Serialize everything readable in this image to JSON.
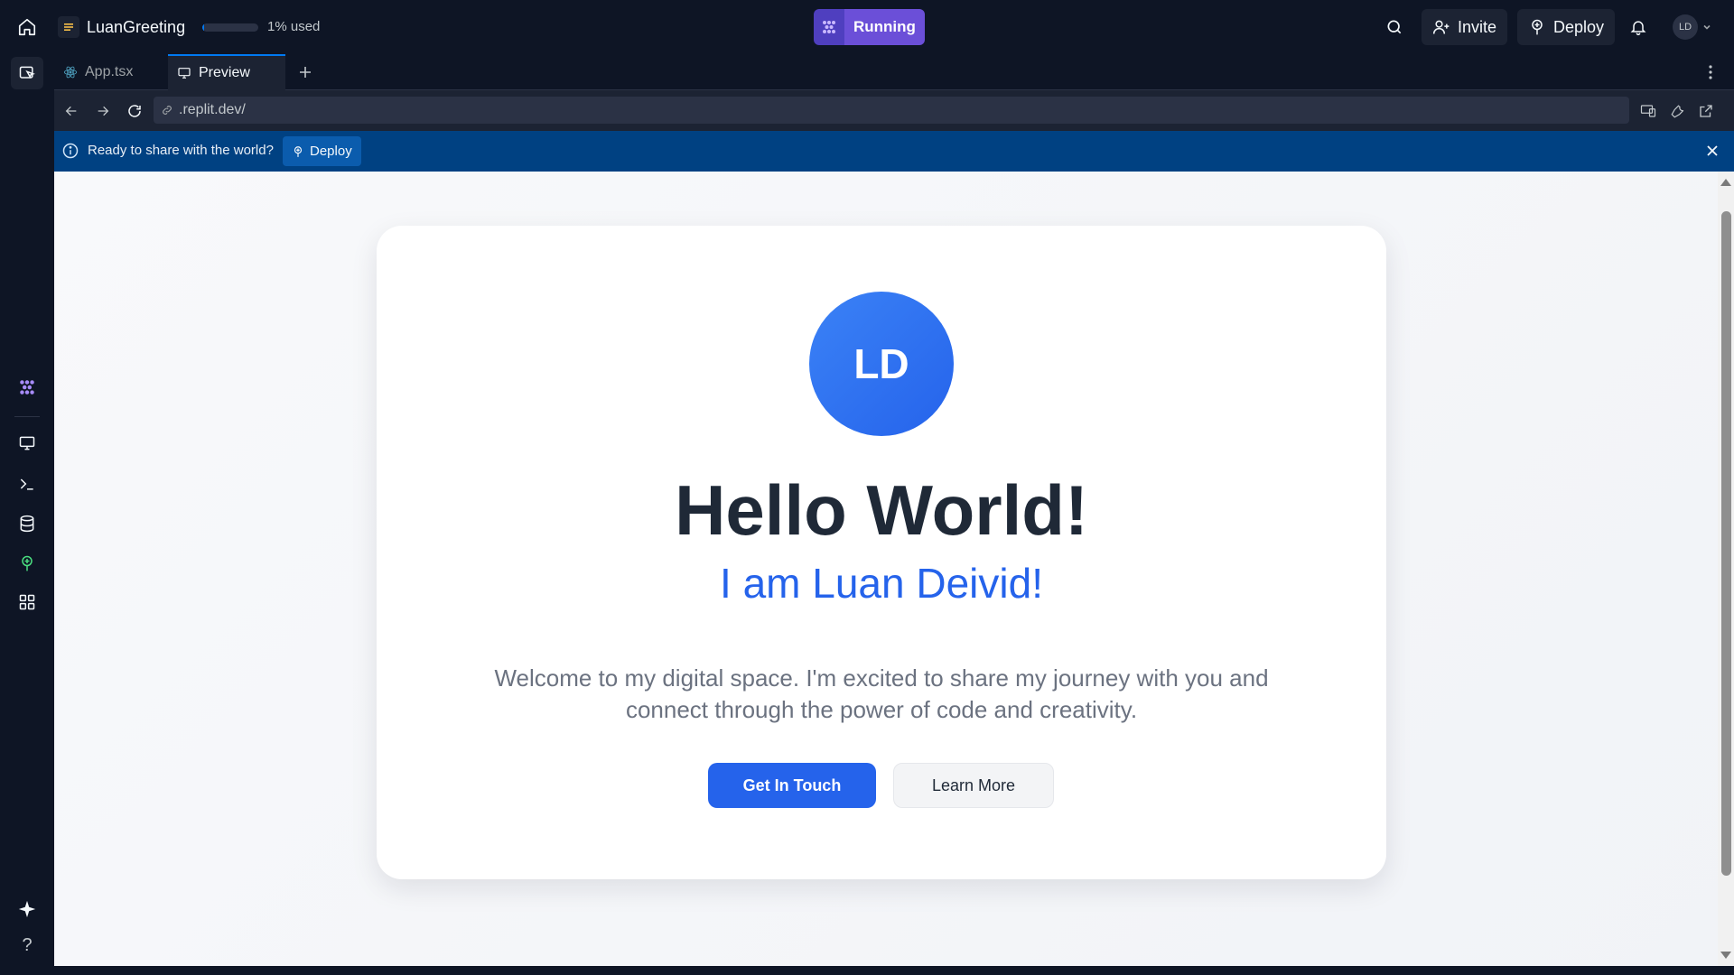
{
  "topbar": {
    "repl_name": "LuanGreeting",
    "usage_text": "1% used",
    "usage_fraction": 0.01,
    "run_label": "Running",
    "invite_label": "Invite",
    "deploy_label": "Deploy",
    "user_initials": "LD"
  },
  "tabs": [
    {
      "label": "App.tsx",
      "icon": "react-icon",
      "active": false
    },
    {
      "label": "Preview",
      "icon": "monitor-icon",
      "active": true
    }
  ],
  "urlbar": {
    "url": ".replit.dev/"
  },
  "banner": {
    "text": "Ready to share with the world?",
    "deploy_label": "Deploy"
  },
  "preview": {
    "avatar_initials": "LD",
    "title": "Hello World!",
    "subtitle": "I am Luan Deivid!",
    "description": "Welcome to my digital space. I'm excited to share my journey with you and connect through the power of code and creativity.",
    "primary_button": "Get In Touch",
    "secondary_button": "Learn More"
  },
  "rail": {
    "help_label": "?"
  },
  "colors": {
    "accent_blue": "#2563eb",
    "run_purple": "#6b4fd8",
    "banner_blue": "#004182",
    "ide_bg": "#0e1525"
  }
}
